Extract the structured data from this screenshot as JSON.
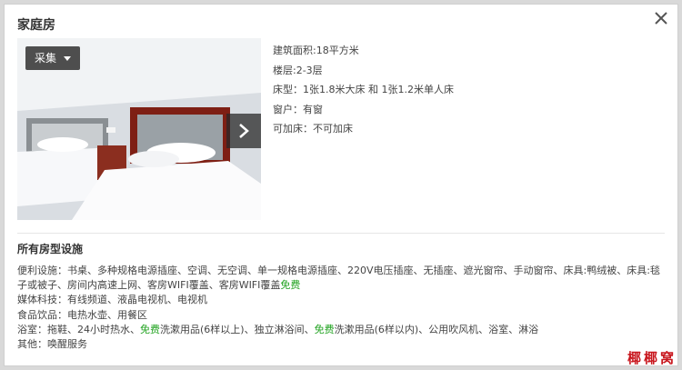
{
  "modal": {
    "title": "家庭房",
    "collect_label": "采集"
  },
  "room_info": [
    "建筑面积:18平方米",
    "楼层:2-3层",
    "床型：1张1.8米大床 和 1张1.2米单人床",
    "窗户：有窗",
    "可加床：不可加床"
  ],
  "facilities": {
    "section_title": "所有房型设施",
    "convenience": {
      "label": "便利设施：",
      "text_a": "书桌、多种规格电源插座、空调、无空调、单一规格电源插座、220V电压插座、无插座、遮光窗帘、手动窗帘、床具:鸭绒被、床具:毯子或被子、房间内高速上网、客房WIFI覆盖、客房WIFI覆盖",
      "free": "免费"
    },
    "media": {
      "label": "媒体科技：",
      "text": "有线频道、液晶电视机、电视机"
    },
    "food": {
      "label": "食品饮品：",
      "text": "电热水壶、用餐区"
    },
    "bath": {
      "label": "浴室：",
      "text_a": "拖鞋、24小时热水、",
      "free_1": "免费",
      "text_b": "洗漱用品(6样以上)、独立淋浴间、",
      "free_2": "免费",
      "text_c": "洗漱用品(6样以内)、公用吹风机、浴室、淋浴"
    },
    "other": {
      "label": "其他：",
      "text": "唤醒服务"
    }
  },
  "watermark": "椰椰窝",
  "colors": {
    "free_text": "#22a321",
    "watermark": "#c8171e"
  }
}
